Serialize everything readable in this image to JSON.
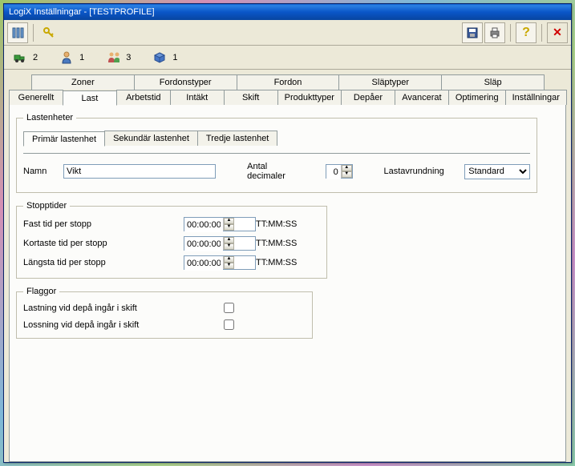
{
  "window": {
    "title": "LogiX Inställningar - [TESTPROFILE]"
  },
  "toolbar": {
    "left_icons": [
      "columns-icon",
      "key-icon"
    ],
    "right_icons": [
      "save-icon",
      "print-icon",
      "help-icon",
      "close-icon"
    ]
  },
  "status": {
    "truck_count": "2",
    "person_count": "1",
    "people_count": "3",
    "cube_count": "1"
  },
  "tabs_row1": [
    {
      "label": "Zoner"
    },
    {
      "label": "Fordonstyper"
    },
    {
      "label": "Fordon"
    },
    {
      "label": "Släptyper"
    },
    {
      "label": "Släp"
    }
  ],
  "tabs_row2": [
    {
      "label": "Generellt"
    },
    {
      "label": "Last",
      "active": true
    },
    {
      "label": "Arbetstid"
    },
    {
      "label": "Intäkt"
    },
    {
      "label": "Skift"
    },
    {
      "label": "Produkttyper"
    },
    {
      "label": "Depåer"
    },
    {
      "label": "Avancerat"
    },
    {
      "label": "Optimering"
    },
    {
      "label": "Inställningar"
    }
  ],
  "lastenheter": {
    "legend": "Lastenheter",
    "subtabs": [
      {
        "label": "Primär lastenhet",
        "active": true
      },
      {
        "label": "Sekundär lastenhet"
      },
      {
        "label": "Tredje lastenhet"
      }
    ],
    "name_label": "Namn",
    "name_value": "Vikt",
    "decimals_label": "Antal decimaler",
    "decimals_value": "0",
    "rounding_label": "Lastavrundning",
    "rounding_value": "Standard"
  },
  "stopptider": {
    "legend": "Stopptider",
    "rows": [
      {
        "label": "Fast tid per stopp",
        "value": "00:00:00",
        "suffix": "TT:MM:SS"
      },
      {
        "label": "Kortaste tid per stopp",
        "value": "00:00:00",
        "suffix": "TT:MM:SS"
      },
      {
        "label": "Längsta tid per stopp",
        "value": "00:00:00",
        "suffix": "TT:MM:SS"
      }
    ]
  },
  "flaggor": {
    "legend": "Flaggor",
    "rows": [
      {
        "label": "Lastning vid depå ingår i skift",
        "checked": false
      },
      {
        "label": "Lossning vid depå ingår i skift",
        "checked": false
      }
    ]
  }
}
